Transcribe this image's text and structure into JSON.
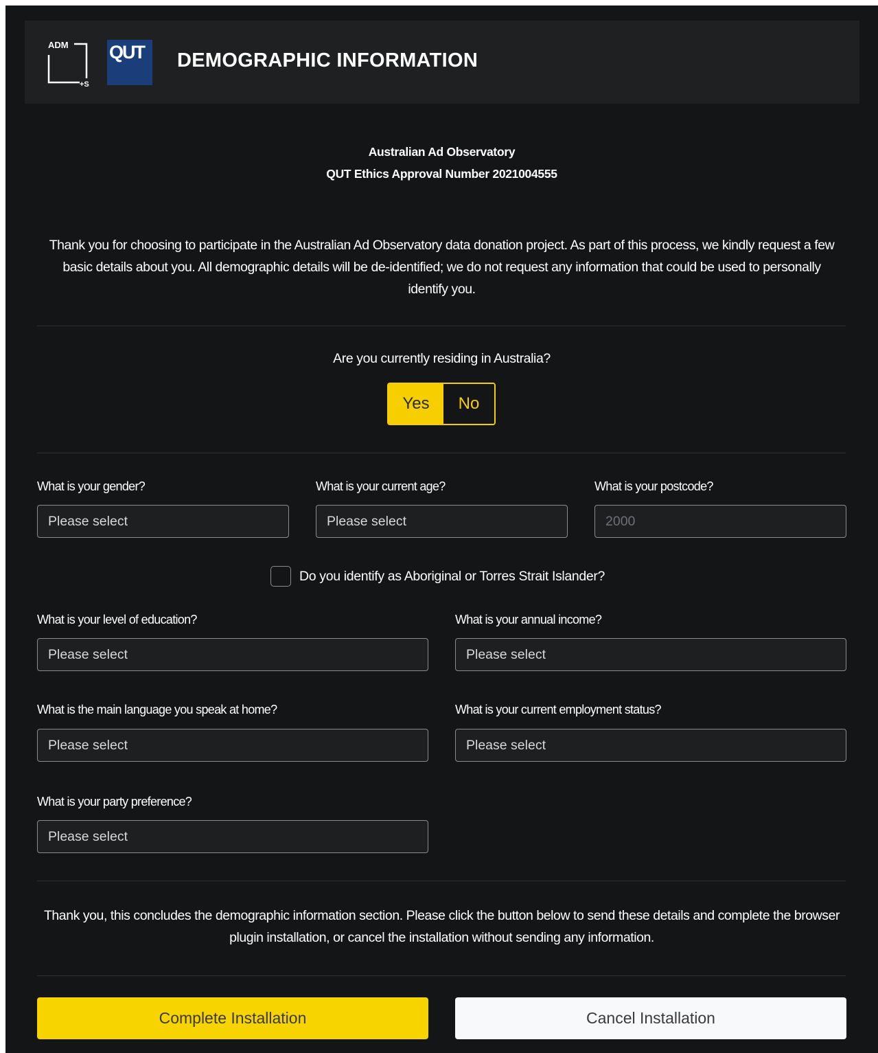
{
  "header": {
    "adm_logo_text": "ADM",
    "adm_logo_suffix": "+S",
    "qut_logo_text": "QUT",
    "title": "DEMOGRAPHIC INFORMATION"
  },
  "project": {
    "name": "Australian Ad Observatory",
    "ethics": "QUT Ethics Approval Number 2021004555"
  },
  "intro_text": "Thank you for choosing to participate in the Australian Ad Observatory data donation project. As part of this process, we kindly request a few basic details about you. All demographic details will be de-identified; we do not request any information that could be used to personally identify you.",
  "residency": {
    "question": "Are you currently residing in Australia?",
    "yes_label": "Yes",
    "no_label": "No",
    "selected": "Yes"
  },
  "fields": {
    "gender": {
      "label": "What is your gender?",
      "value": "Please select"
    },
    "age": {
      "label": "What is your current age?",
      "value": "Please select"
    },
    "postcode": {
      "label": "What is your postcode?",
      "placeholder": "2000"
    },
    "aboriginal": {
      "label": "Do you identify as Aboriginal or Torres Strait Islander?",
      "checked": false
    },
    "education": {
      "label": "What is your level of education?",
      "value": "Please select"
    },
    "income": {
      "label": "What is your annual income?",
      "value": "Please select"
    },
    "language": {
      "label": "What is the main language you speak at home?",
      "value": "Please select"
    },
    "employment": {
      "label": "What is your current employment status?",
      "value": "Please select"
    },
    "party": {
      "label": "What is your party preference?",
      "value": "Please select"
    }
  },
  "outro_text": "Thank you, this concludes the demographic information section. Please click the button below to send these details and complete the browser plugin installation, or cancel the installation without sending any information.",
  "buttons": {
    "complete": "Complete Installation",
    "cancel": "Cancel Installation"
  },
  "colors": {
    "background": "#141517",
    "header": "#1f2022",
    "accent": "#f7cf00",
    "qut_blue": "#1b3e7a"
  }
}
